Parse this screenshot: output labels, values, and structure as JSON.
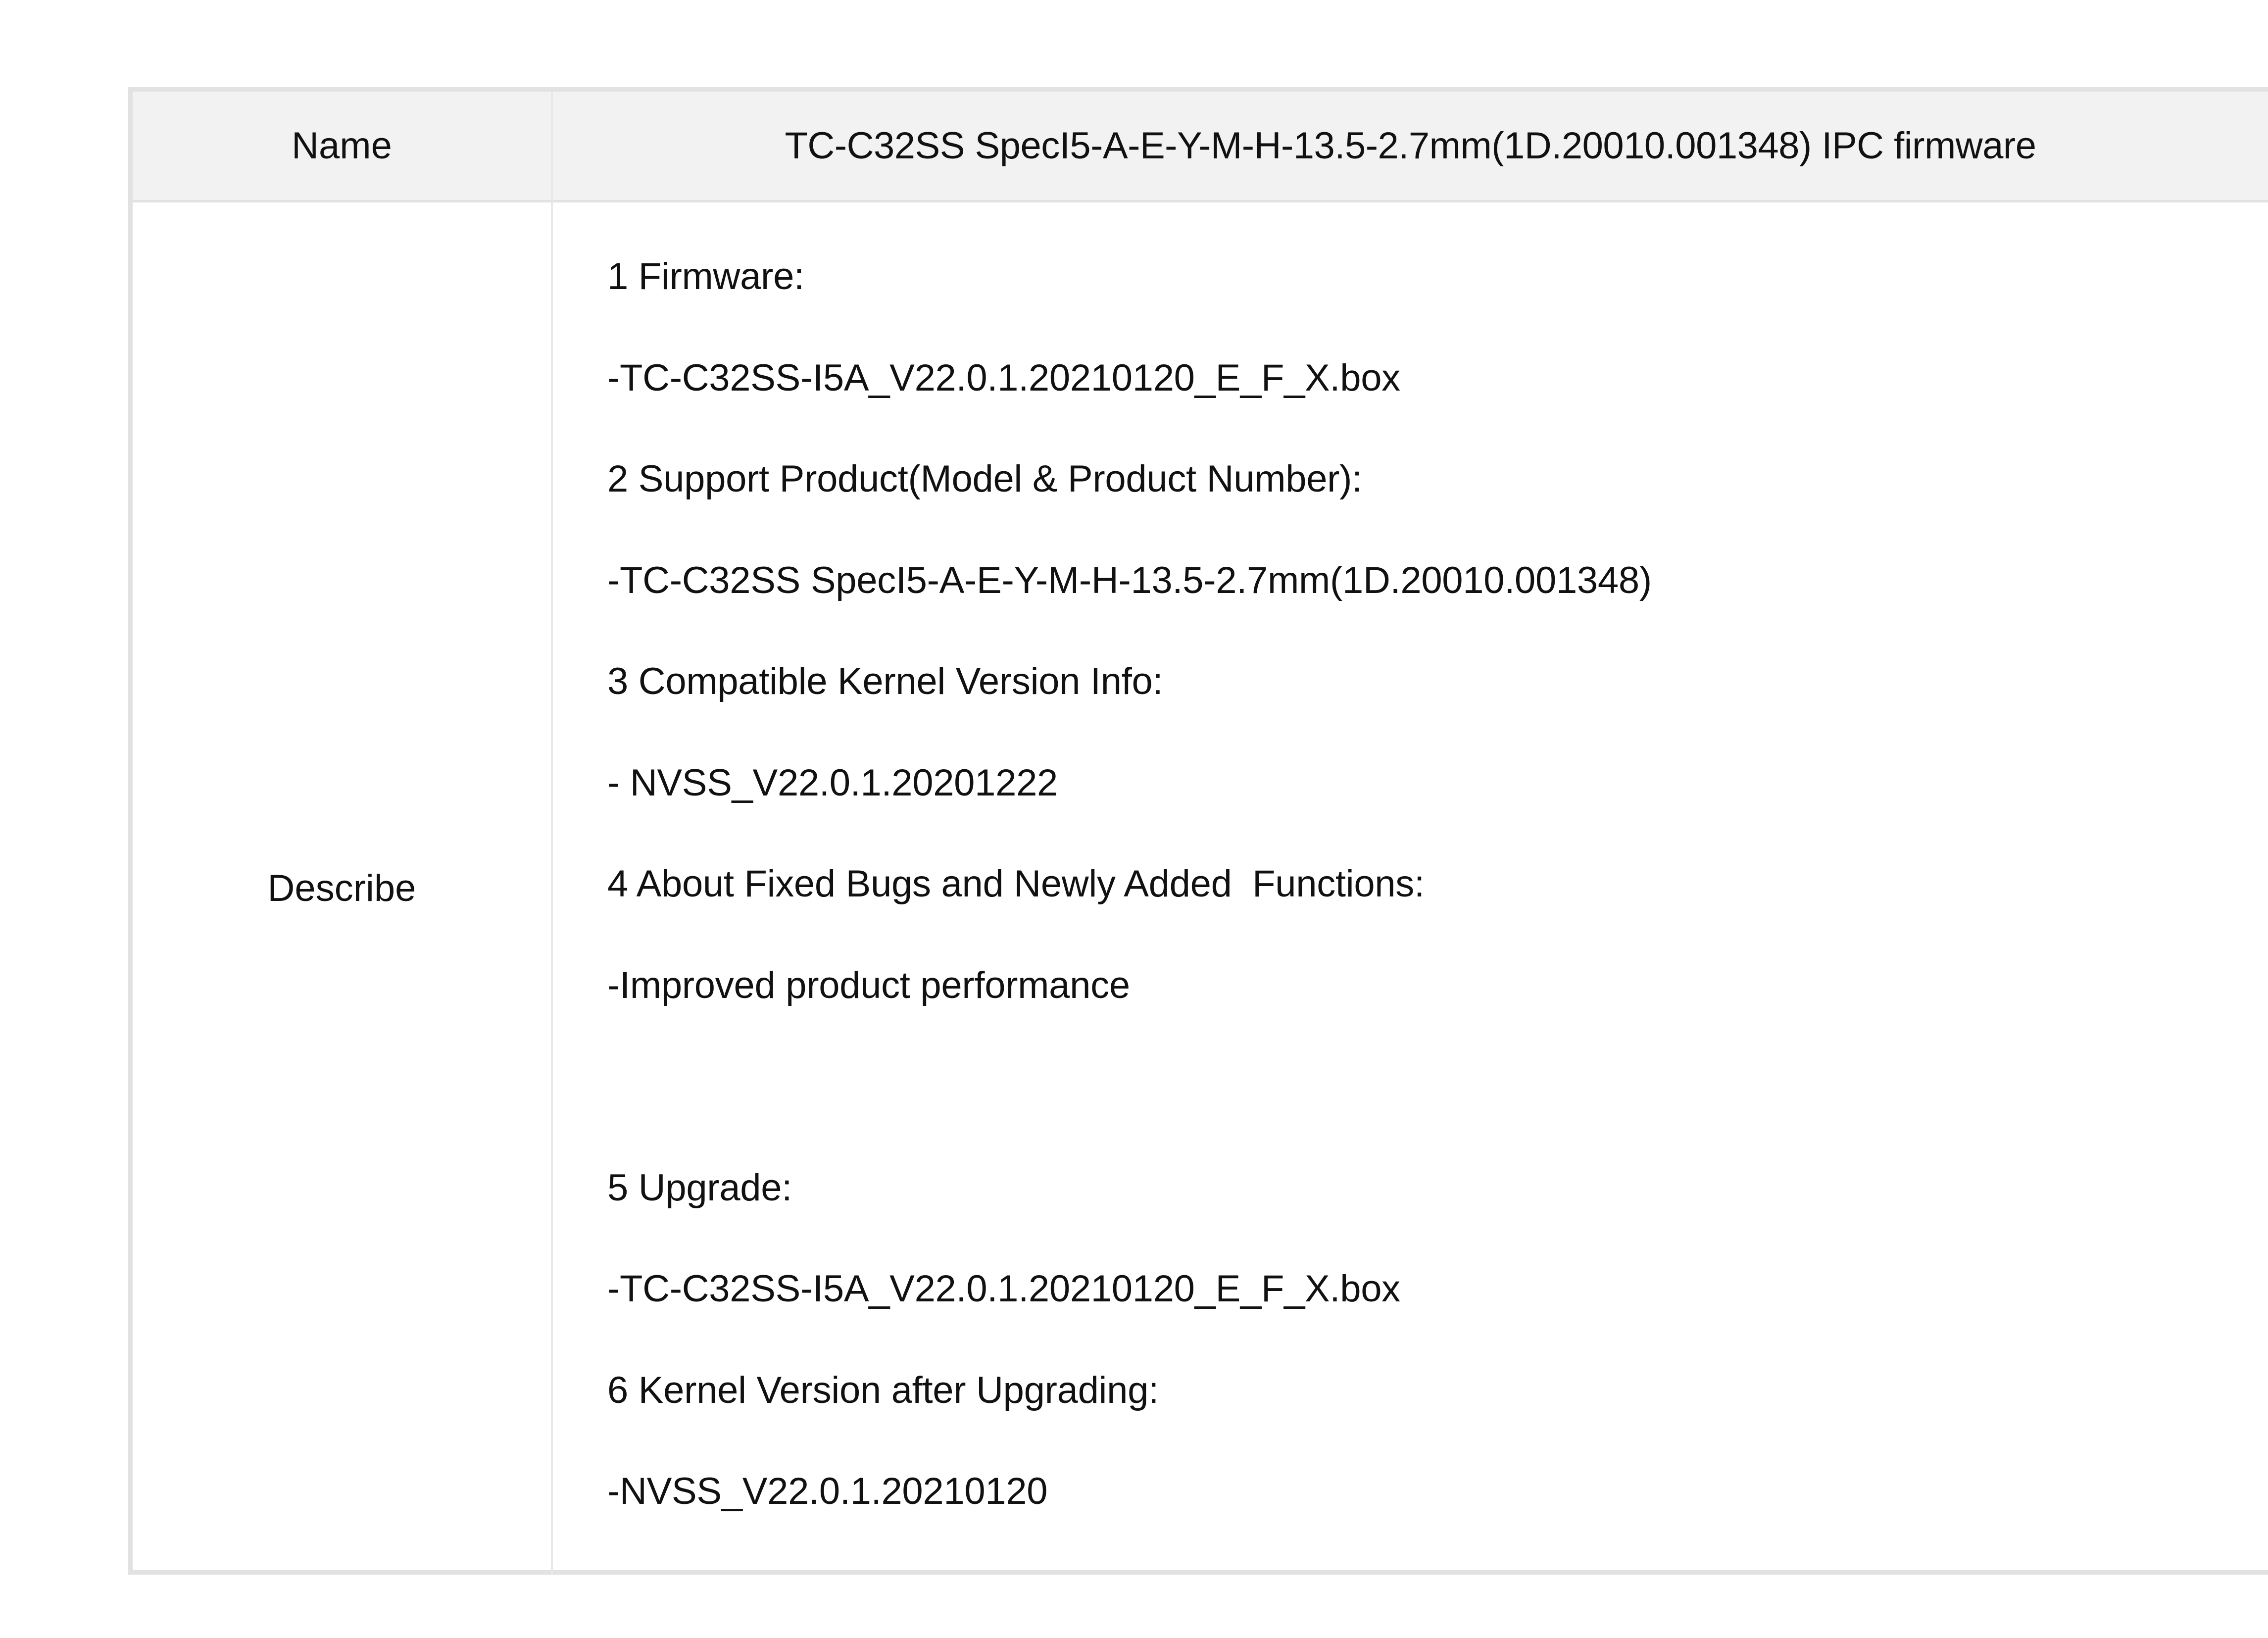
{
  "table": {
    "name_label": "Name",
    "name_value": "TC-C32SS SpecI5-A-E-Y-M-H-13.5-2.7mm(1D.20010.001348) IPC firmware",
    "describe_label": "Describe",
    "describe_lines": [
      "1 Firmware:",
      "-TC-C32SS-I5A_V22.0.1.20210120_E_F_X.box",
      "2 Support Product(Model & Product Number):",
      "-TC-C32SS SpecI5-A-E-Y-M-H-13.5-2.7mm(1D.20010.001348)",
      "3 Compatible Kernel Version Info:",
      "- NVSS_V22.0.1.20201222",
      "4 About Fixed Bugs and Newly Added  Functions:",
      "-Improved product performance",
      "",
      "5 Upgrade:",
      "-TC-C32SS-I5A_V22.0.1.20210120_E_F_X.box",
      "6 Kernel Version after Upgrading:",
      "-NVSS_V22.0.1.20210120"
    ]
  }
}
